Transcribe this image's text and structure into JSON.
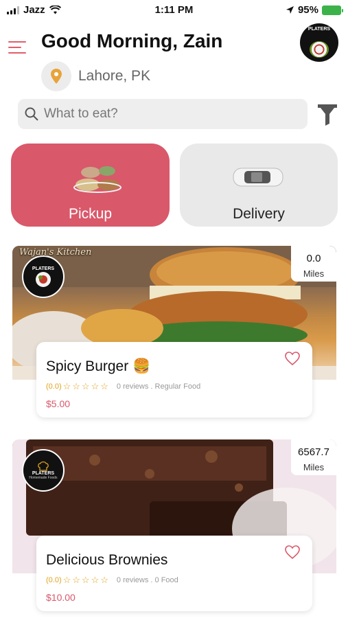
{
  "status_bar": {
    "carrier": "Jazz",
    "time": "1:11 PM",
    "battery": "95%"
  },
  "header": {
    "greeting": "Good Morning, Zain",
    "location": "Lahore, PK"
  },
  "search": {
    "placeholder": "What to eat?"
  },
  "modes": [
    {
      "label": "Pickup",
      "active": true
    },
    {
      "label": "Delivery",
      "active": false
    }
  ],
  "restaurants": [
    {
      "brand_overlay": "Wajan's Kitchen",
      "logo_text": "PLATERS",
      "distance": "0.0",
      "distance_unit": "Miles",
      "title": "Spicy Burger 🍔",
      "rating": "(0.0)",
      "stars": "☆☆☆☆☆",
      "meta": "0 reviews . Regular Food",
      "price": "$5.00"
    },
    {
      "logo_text": "PLATERS",
      "logo_sub": "Homemade Foods",
      "distance": "6567.7",
      "distance_unit": "Miles",
      "title": "Delicious Brownies",
      "rating": "(0.0)",
      "stars": "☆☆☆☆☆",
      "meta": "0 reviews . 0 Food",
      "price": "$10.00"
    }
  ],
  "colors": {
    "accent": "#d9586a",
    "star": "#e0a21a",
    "pin": "#e8a33a"
  }
}
